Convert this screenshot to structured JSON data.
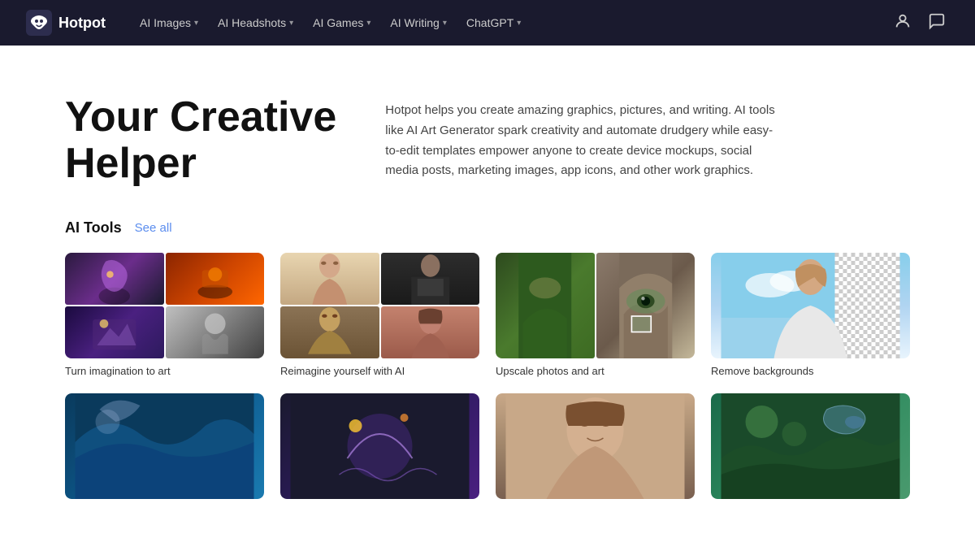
{
  "nav": {
    "logo_text": "Hotpot",
    "links": [
      {
        "label": "AI Images",
        "has_dropdown": true
      },
      {
        "label": "AI Headshots",
        "has_dropdown": true
      },
      {
        "label": "AI Games",
        "has_dropdown": true
      },
      {
        "label": "AI Writing",
        "has_dropdown": true
      },
      {
        "label": "ChatGPT",
        "has_dropdown": true
      }
    ]
  },
  "hero": {
    "title_line1": "Your Creative",
    "title_line2": "Helper",
    "description": "Hotpot helps you create amazing graphics, pictures, and writing. AI tools like AI Art Generator spark creativity and automate drudgery while easy-to-edit templates empower anyone to create device mockups, social media posts, marketing images, app icons, and other work graphics."
  },
  "tools": {
    "section_label": "AI Tools",
    "see_all": "See all",
    "cards": [
      {
        "label": "Turn imagination to art"
      },
      {
        "label": "Reimagine yourself with AI"
      },
      {
        "label": "Upscale photos and art"
      },
      {
        "label": "Remove backgrounds"
      },
      {
        "label": ""
      },
      {
        "label": ""
      },
      {
        "label": ""
      },
      {
        "label": ""
      }
    ]
  }
}
